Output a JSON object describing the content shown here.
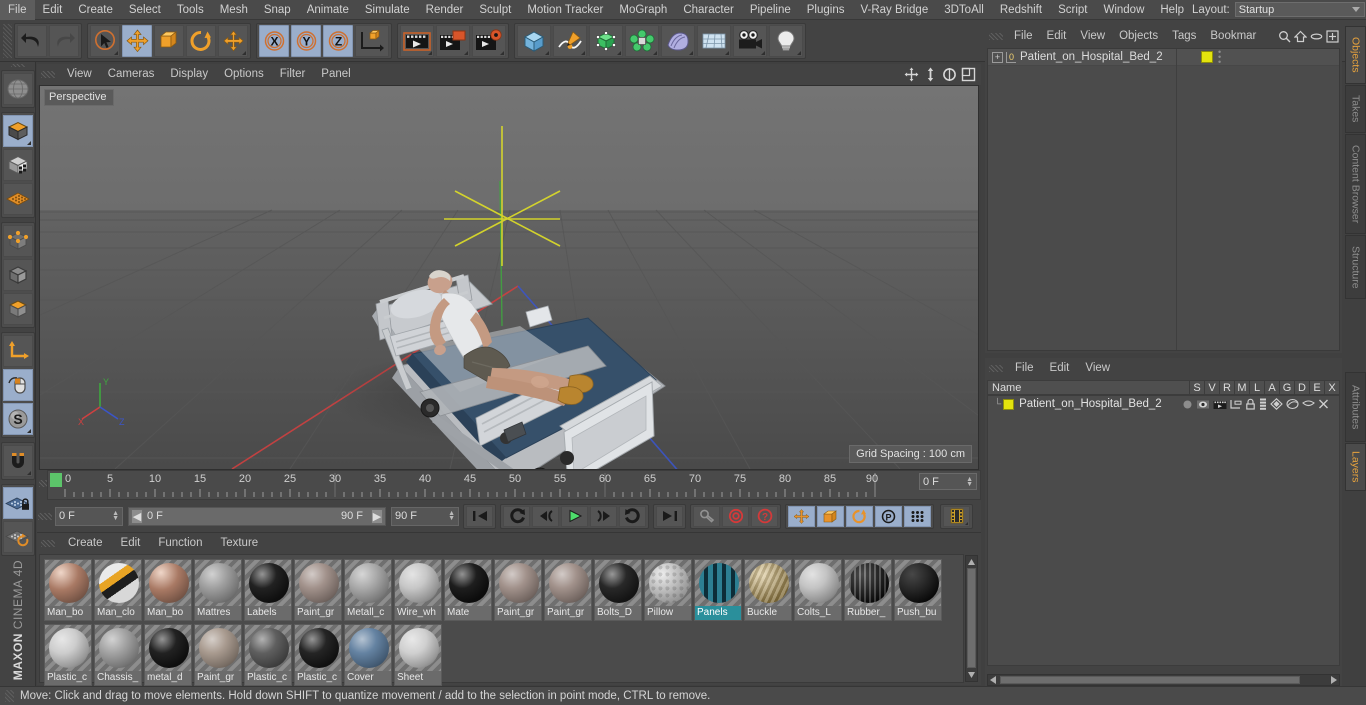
{
  "app": {
    "title": "Cinema 4D",
    "brand_top": "MAXON",
    "brand_bottom": "CINEMA 4D"
  },
  "menubar": {
    "items": [
      "File",
      "Edit",
      "Create",
      "Select",
      "Tools",
      "Mesh",
      "Snap",
      "Animate",
      "Simulate",
      "Render",
      "Sculpt",
      "Motion Tracker",
      "MoGraph",
      "Character",
      "Pipeline",
      "Plugins",
      "V-Ray Bridge",
      "3DToAll",
      "Redshift",
      "Script",
      "Window",
      "Help"
    ],
    "layout_label": "Layout:",
    "layout_value": "Startup",
    "search_icon": "search-icon"
  },
  "toolbar": {
    "groups": [
      {
        "name": "history",
        "buttons": [
          {
            "name": "undo-button",
            "icon": "undo-arrow-icon",
            "active": false
          },
          {
            "name": "redo-button",
            "icon": "redo-arrow-icon",
            "active": false
          }
        ]
      },
      {
        "name": "tools",
        "buttons": [
          {
            "name": "live-selection-button",
            "icon": "cursor-circle-icon",
            "active": false
          },
          {
            "name": "move-tool-button",
            "icon": "move-arrows-icon",
            "active": true
          },
          {
            "name": "scale-tool-button",
            "icon": "scale-box-icon",
            "active": false
          },
          {
            "name": "rotate-tool-button",
            "icon": "rotate-arc-icon",
            "active": false
          },
          {
            "name": "dynamic-place-button",
            "icon": "move-arrows-icon",
            "active": false
          }
        ]
      },
      {
        "name": "axis-locks",
        "buttons": [
          {
            "name": "lock-x-button",
            "icon": "axis-x-icon",
            "active": true
          },
          {
            "name": "lock-y-button",
            "icon": "axis-y-icon",
            "active": true
          },
          {
            "name": "lock-z-button",
            "icon": "axis-z-icon",
            "active": true
          },
          {
            "name": "world-coordinates-button",
            "icon": "world-axis-cube-icon",
            "active": false
          }
        ]
      },
      {
        "name": "render",
        "buttons": [
          {
            "name": "render-view-button",
            "icon": "clapperboard-icon",
            "active": false
          },
          {
            "name": "render-to-picture-viewer-button",
            "icon": "clapperboard-window-icon",
            "active": false
          },
          {
            "name": "render-settings-button",
            "icon": "clapperboard-gear-icon",
            "active": false
          }
        ]
      },
      {
        "name": "create",
        "buttons": [
          {
            "name": "add-cube-button",
            "icon": "blue-cube-icon",
            "active": false
          },
          {
            "name": "add-spline-button",
            "icon": "pen-spline-icon",
            "active": false
          },
          {
            "name": "add-generator-button",
            "icon": "green-cube-icon",
            "active": false
          },
          {
            "name": "add-deformer-button",
            "icon": "green-cluster-icon",
            "active": false
          },
          {
            "name": "add-scene-button",
            "icon": "purple-shape-icon",
            "active": false
          },
          {
            "name": "add-floor-button",
            "icon": "floor-grid-icon",
            "active": false
          },
          {
            "name": "add-camera-button",
            "icon": "camera-icon",
            "active": false
          },
          {
            "name": "add-light-button",
            "icon": "lightbulb-icon",
            "active": false
          }
        ]
      }
    ]
  },
  "left_toolbar": {
    "buttons": [
      {
        "name": "undo-view-button",
        "icon": "globe-grid-icon",
        "active": false
      },
      {
        "name": "make-editable-button",
        "icon": "editable-cube-icon",
        "active": true
      },
      {
        "name": "model-mode-button",
        "icon": "model-cube-icon",
        "active": false
      },
      {
        "name": "texture-mode-button",
        "icon": "texture-grid-icon",
        "active": false
      },
      {
        "name": "points-mode-button",
        "icon": "points-cube-icon",
        "active": false
      },
      {
        "name": "edges-mode-button",
        "icon": "edges-cube-icon",
        "active": false
      },
      {
        "name": "polygons-mode-button",
        "icon": "polygons-cube-icon",
        "active": false
      },
      {
        "name": "axis-modify-button",
        "icon": "axis-arrow-icon",
        "active": false
      },
      {
        "name": "enable-axis-button",
        "icon": "mouse-icon",
        "active": true
      },
      {
        "name": "soft-selection-button",
        "icon": "s-sphere-icon",
        "active": true
      },
      {
        "name": "snap-button",
        "icon": "magnet-icon",
        "active": false
      },
      {
        "name": "workplane-lock-button",
        "icon": "grid-lock-icon",
        "active": true
      },
      {
        "name": "workplane-reset-button",
        "icon": "grid-reset-icon",
        "active": false
      }
    ]
  },
  "viewport": {
    "menu": [
      "View",
      "Cameras",
      "Display",
      "Options",
      "Filter",
      "Panel"
    ],
    "label": "Perspective",
    "grid_spacing": "Grid Spacing : 100 cm",
    "icons": [
      "pan-view-icon",
      "dolly-view-icon",
      "rotate-view-icon",
      "maximize-view-icon"
    ],
    "axis": {
      "x": "X",
      "y": "Y",
      "z": "Z"
    }
  },
  "timeline": {
    "ticks": [
      "0",
      "5",
      "10",
      "15",
      "20",
      "25",
      "30",
      "35",
      "40",
      "45",
      "50",
      "55",
      "60",
      "65",
      "70",
      "75",
      "80",
      "85",
      "90"
    ],
    "current_frame_field": "0 F",
    "start_frame": "0 F",
    "range_start": "0 F",
    "range_end": "90 F",
    "end_frame": "90 F",
    "playback_buttons": [
      {
        "name": "go-to-start-button",
        "icon": "skip-start-icon",
        "active": false
      },
      {
        "name": "previous-keyframe-button",
        "icon": "rewind-key-icon",
        "active": false
      },
      {
        "name": "previous-frame-button",
        "icon": "step-back-icon",
        "active": false
      },
      {
        "name": "play-button",
        "icon": "play-icon",
        "active": false
      },
      {
        "name": "next-frame-button",
        "icon": "step-forward-icon",
        "active": false
      },
      {
        "name": "next-keyframe-button",
        "icon": "forward-key-icon",
        "active": false
      },
      {
        "name": "go-to-end-button",
        "icon": "skip-end-icon",
        "active": false
      }
    ],
    "record_buttons": [
      {
        "name": "autokeying-button",
        "icon": "key-icon",
        "active": false
      },
      {
        "name": "record-active-objects-button",
        "icon": "record-circle-icon",
        "active": false
      },
      {
        "name": "keyframe-selection-button",
        "icon": "question-circle-icon",
        "active": false
      }
    ],
    "key_toggles": [
      {
        "name": "position-key-button",
        "icon": "move-arrows-icon",
        "active": true
      },
      {
        "name": "scale-key-button",
        "icon": "scale-box-icon",
        "active": true
      },
      {
        "name": "rotation-key-button",
        "icon": "rotate-arc-icon",
        "active": true
      },
      {
        "name": "parameter-key-button",
        "icon": "p-circle-icon",
        "active": true
      },
      {
        "name": "point-level-animation-button",
        "icon": "dots-grid-icon",
        "active": true
      }
    ],
    "extra_button": {
      "name": "timeline-filmstrip-button",
      "icon": "filmstrip-icon",
      "active": false
    }
  },
  "material_manager": {
    "menu": [
      "Create",
      "Edit",
      "Function",
      "Texture"
    ],
    "materials": [
      {
        "name": "Man_bo",
        "color": "#c08a72",
        "thumb": "skin",
        "selected": false
      },
      {
        "name": "Man_clo",
        "color": "#cfcfcf",
        "thumb": "mixed",
        "selected": false
      },
      {
        "name": "Man_bo",
        "color": "#c08a72",
        "thumb": "skin",
        "selected": false
      },
      {
        "name": "Mattres",
        "color": "#9a9a9a",
        "thumb": "plain",
        "selected": false
      },
      {
        "name": "Labels",
        "color": "#141414",
        "thumb": "plain",
        "selected": false
      },
      {
        "name": "Paint_gr",
        "color": "#9c8b84",
        "thumb": "plain",
        "selected": false
      },
      {
        "name": "Metall_c",
        "color": "#a5a5a5",
        "thumb": "plain",
        "selected": false
      },
      {
        "name": "Wire_wh",
        "color": "#c4c4c4",
        "thumb": "plain",
        "selected": false
      },
      {
        "name": "Mate",
        "color": "#101010",
        "thumb": "plain",
        "selected": false
      },
      {
        "name": "Paint_gr",
        "color": "#9c8b84",
        "thumb": "plain",
        "selected": false
      },
      {
        "name": "Paint_gr",
        "color": "#9c8b84",
        "thumb": "plain",
        "selected": false
      },
      {
        "name": "Bolts_D",
        "color": "#1b1b1b",
        "thumb": "plain",
        "selected": false
      },
      {
        "name": "Pillow",
        "color": "#d2d2d2",
        "thumb": "bumpy",
        "selected": false
      },
      {
        "name": "Panels",
        "color": "#1d5e6b",
        "thumb": "panel",
        "selected": true
      },
      {
        "name": "Buckle",
        "color": "#c8a85a",
        "thumb": "stripe",
        "selected": false
      },
      {
        "name": "Colts_L",
        "color": "#c0c0c0",
        "thumb": "plain",
        "selected": false
      },
      {
        "name": "Rubber_",
        "color": "#1a1a1a",
        "thumb": "ribbed",
        "selected": false
      },
      {
        "name": "Push_bu",
        "color": "#141414",
        "thumb": "text",
        "selected": false
      },
      {
        "name": "Plastic_c",
        "color": "#cacaca",
        "thumb": "plain",
        "selected": false
      },
      {
        "name": "Chassis_",
        "color": "#9d9d9d",
        "thumb": "plain",
        "selected": false
      },
      {
        "name": "metal_d",
        "color": "#141414",
        "thumb": "plain",
        "selected": false
      },
      {
        "name": "Paint_gr",
        "color": "#a39488",
        "thumb": "plain",
        "selected": false
      },
      {
        "name": "Plastic_c",
        "color": "#555555",
        "thumb": "plain",
        "selected": false
      },
      {
        "name": "Plastic_c",
        "color": "#171717",
        "thumb": "plain",
        "selected": false
      },
      {
        "name": "Cover",
        "color": "#5b7b9c",
        "thumb": "plain",
        "selected": false
      },
      {
        "name": "Sheet",
        "color": "#cdcdcd",
        "thumb": "plain",
        "selected": false
      }
    ]
  },
  "object_manager": {
    "menu": [
      "File",
      "Edit",
      "View",
      "Objects",
      "Tags",
      "Bookmar"
    ],
    "header_icons": [
      "search-icon",
      "home-icon",
      "ellipse-icon",
      "plus-box-icon"
    ],
    "rows": [
      {
        "name": "Patient_on_Hospital_Bed_2",
        "level_badge": "0",
        "tag_color": "#e3e30d"
      }
    ]
  },
  "layer_manager": {
    "menu": [
      "File",
      "Edit",
      "View"
    ],
    "columns": [
      "Name",
      "S",
      "V",
      "R",
      "M",
      "L",
      "A",
      "G",
      "D",
      "E",
      "X"
    ],
    "rows": [
      {
        "name": "Patient_on_Hospital_Bed_2",
        "color": "#e3e30d"
      }
    ]
  },
  "side_tabs": {
    "top": [
      {
        "label": "Objects",
        "active": true
      },
      {
        "label": "Takes",
        "active": false
      },
      {
        "label": "Content Browser",
        "active": false
      },
      {
        "label": "Structure",
        "active": false
      }
    ],
    "bottom": [
      {
        "label": "Attributes",
        "active": false
      },
      {
        "label": "Layers",
        "active": true
      }
    ]
  },
  "statusbar": {
    "text": "Move: Click and drag to move elements. Hold down SHIFT to quantize movement / add to the selection in point mode, CTRL to remove."
  }
}
